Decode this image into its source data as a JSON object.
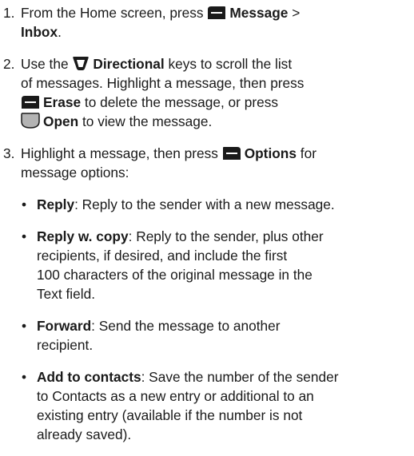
{
  "steps": [
    {
      "number": "1.",
      "t1": "From the Home screen, press",
      "key1_label": "Message",
      "sep": ">",
      "key2_label": "Inbox",
      "end": "."
    },
    {
      "number": "2.",
      "t1": "Use the",
      "dir_label": "Directional",
      "t2": "keys to scroll the list",
      "t3": "of messages. Highlight a message, then press",
      "erase_label": "Erase",
      "t4": "to delete the message, or press",
      "open_label": "Open",
      "t5": "to view the message."
    },
    {
      "number": "3.",
      "t1": "Highlight a message, then press",
      "options_label": "Options",
      "t2": "for",
      "t3": "message options:"
    }
  ],
  "options": [
    {
      "title": "Reply",
      "lines": [
        ": Reply to the sender with a new message."
      ]
    },
    {
      "title": "Reply w. copy",
      "lines": [
        ": Reply to the sender, plus other",
        "recipients, if desired, and include the first",
        "100 characters of the original message in the",
        "Text field."
      ]
    },
    {
      "title": "Forward",
      "lines": [
        ": Send the message to another",
        "recipient."
      ]
    },
    {
      "title": "Add to contacts",
      "lines": [
        ": Save the number of the sender",
        "to Contacts as a new entry or additional to an",
        "existing entry (available if the number is not",
        "already saved)."
      ]
    }
  ],
  "bullet_char": "•",
  "icons": {
    "left_softkey": "left-softkey-icon",
    "right_softkey": "right-softkey-icon",
    "directional": "directional-key-icon",
    "center_key": "center-key-icon",
    "color": "#1a1a1a"
  }
}
